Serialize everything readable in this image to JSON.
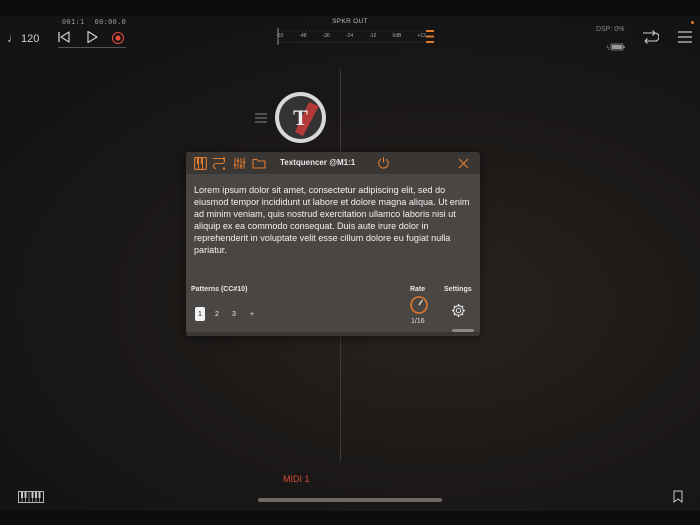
{
  "transport": {
    "tempo": "120",
    "tempo_glyph": "♩",
    "bar_position": "001:1",
    "time_position": "00:00.0"
  },
  "meter": {
    "title": "SPKR OUT",
    "scale": [
      "-60",
      "-48",
      "-36",
      "-24",
      "-12",
      "0dB",
      "+12"
    ]
  },
  "status": {
    "dsp": "DSP: 0%"
  },
  "plugin": {
    "node_letter": "T",
    "title": "Textquencer @M1:1",
    "body_text": "Lorem ipsum dolor sit amet, consectetur adipiscing elit, sed do eiusmod tempor incididunt ut labore et dolore magna aliqua. Ut enim ad minim veniam, quis nostrud exercitation ullamco laboris nisi ut aliquip ex ea commodo consequat. Duis aute irure dolor in reprehenderit in voluptate velit esse cillum dolore eu fugiat nulla pariatur.",
    "patterns_label": "Patterns (CC#10)",
    "patterns": [
      "1",
      "2",
      "3",
      "+"
    ],
    "selected_pattern": "1",
    "rate_label": "Rate",
    "rate_value": "1/16",
    "settings_label": "Settings"
  },
  "channel": {
    "label": "MIDI 1"
  },
  "colors": {
    "accent": "#e07a2e",
    "record": "#e5493a",
    "midi_label": "#d64b3a",
    "panel_bg": "#4a4644",
    "panel_header": "#3a3634"
  }
}
